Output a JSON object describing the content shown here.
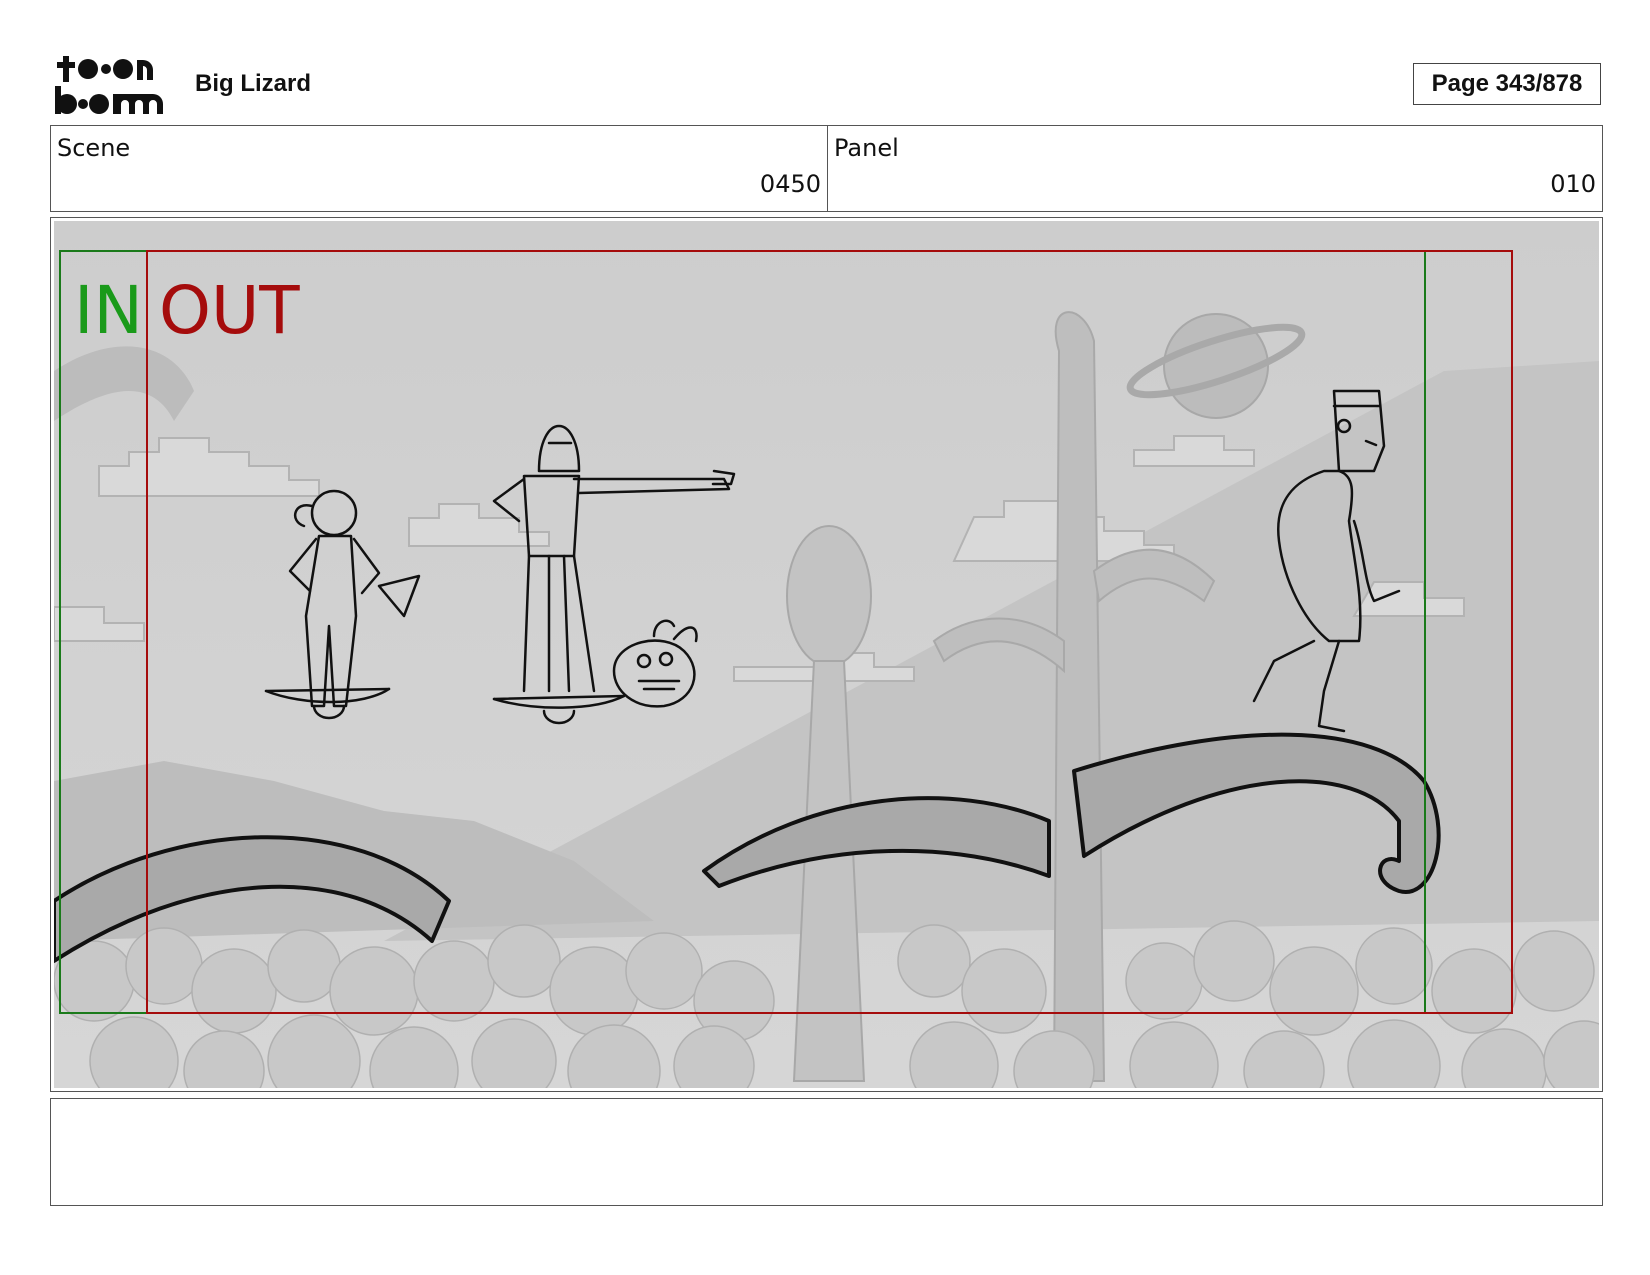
{
  "header": {
    "logo_line1": "toon",
    "logo_line2": "boom",
    "project_title": "Big Lizard",
    "page_indicator": "Page 343/878"
  },
  "info": {
    "scene_label": "Scene",
    "scene_value": "0450",
    "panel_label": "Panel",
    "panel_value": "010"
  },
  "frame": {
    "in_marker": "IN",
    "out_marker": "OUT",
    "colors": {
      "in": "#1a9a1a",
      "out": "#a50c0c",
      "background": "#cfcfcf"
    }
  },
  "notes": {
    "text": ""
  }
}
